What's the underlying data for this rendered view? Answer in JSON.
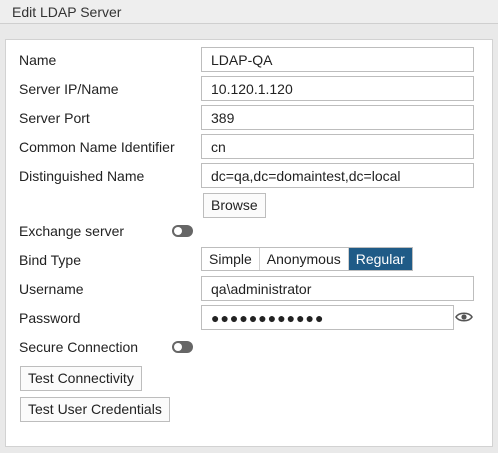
{
  "window": {
    "title": "Edit LDAP Server"
  },
  "form": {
    "name": {
      "label": "Name",
      "value": "LDAP-QA"
    },
    "server": {
      "label": "Server IP/Name",
      "value": "10.120.1.120"
    },
    "port": {
      "label": "Server Port",
      "value": "389"
    },
    "cn_identifier": {
      "label": "Common Name Identifier",
      "value": "cn"
    },
    "distinguished_name": {
      "label": "Distinguished Name",
      "value": "dc=qa,dc=domaintest,dc=local"
    },
    "browse_label": "Browse",
    "exchange": {
      "label": "Exchange server",
      "enabled": false
    },
    "bind_type": {
      "label": "Bind Type",
      "options": [
        "Simple",
        "Anonymous",
        "Regular"
      ],
      "selected": "Regular"
    },
    "username": {
      "label": "Username",
      "value": "qa\\administrator"
    },
    "password": {
      "label": "Password",
      "value": "●●●●●●●●●●●●"
    },
    "secure": {
      "label": "Secure Connection",
      "enabled": false
    },
    "test_connectivity_label": "Test Connectivity",
    "test_credentials_label": "Test User Credentials"
  },
  "icons": {
    "password_reveal": "eye-icon"
  },
  "colors": {
    "selected_segment": "#1f5b87",
    "toggle_off": "#666666"
  }
}
